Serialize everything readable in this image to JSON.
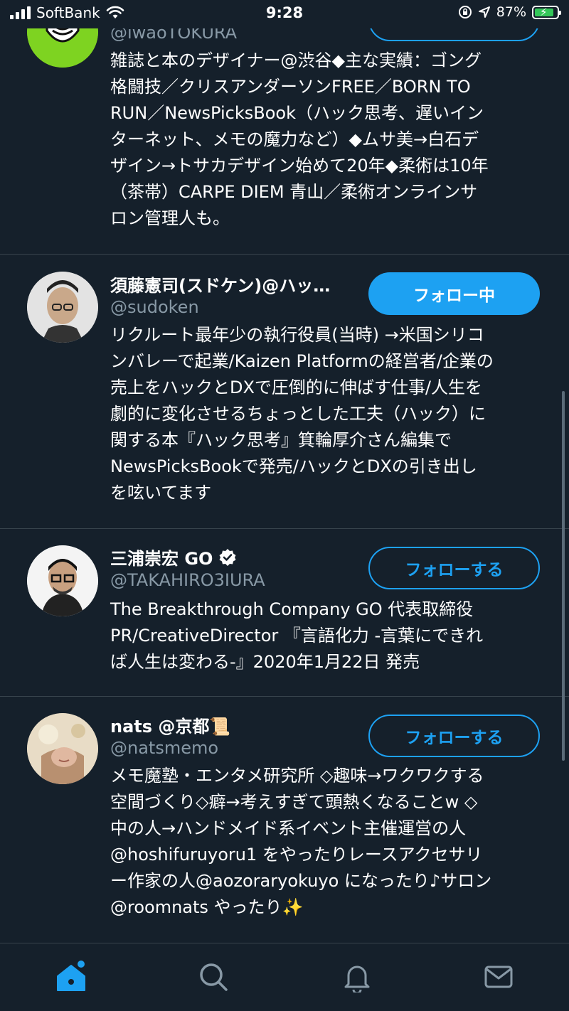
{
  "status_bar": {
    "carrier": "SoftBank",
    "time": "9:28",
    "battery_percent": "87%",
    "battery_level": 0.87,
    "icons": [
      "signal-icon",
      "wifi-icon",
      "lock-rotation-icon",
      "location-icon",
      "battery-icon"
    ]
  },
  "users": [
    {
      "name": "",
      "handle": "@iwaoTOKURA",
      "bio": "雑誌と本のデザイナー@渋谷◆主な実績：ゴング\n格闘技／クリスアンダーソンFREE／BORN TO\nRUN／NewsPicksBook（ハック思考、遅いイン\nターネット、メモの魔力など）◆ムサ美→白石デ\nザイン→トサカデザイン始めて20年◆柔術は10年\n（茶帯）CARPE DIEM 青山／柔術オンラインサ\nロン管理人も。",
      "avatar_color": "#7ed321"
    },
    {
      "name": "須藤憲司(スドケン)@ハッ…",
      "handle": "@sudoken",
      "follow_label": "フォロー中",
      "bio": "リクルート最年少の執行役員(当時) →米国シリコ\nンバレーで起業/Kaizen Platformの経営者/企業の\n売上をハックとDXで圧倒的に伸ばす仕事/人生を\n劇的に変化させるちょっとした工夫（ハック）に\n関する本『ハック思考』箕輪厚介さん編集で\nNewsPicksBookで発売/ハックとDXの引き出し\nを呟いてます"
    },
    {
      "name": "三浦崇宏 GO",
      "handle": "@TAKAHIRO3IURA",
      "follow_label": "フォローする",
      "verified": true,
      "bio": "The Breakthrough Company GO 代表取締役\nPR/CreativeDirector 『言語化力 -言葉にできれ\nば人生は変わる-』2020年1月22日 発売"
    },
    {
      "name": "nats @京都📜",
      "handle": "@natsmemo",
      "follow_label": "フォローする",
      "bio": "メモ魔塾・エンタメ研究所 ◇趣味→ワクワクする\n空間づくり◇癖→考えすぎて頭熱くなることw ◇\n中の人→ハンドメイド系イベント主催運営の人\n@hoshifuruyoru1 をやったりレースアクセサリ\nー作家の人@aozoraryokuyo になったり♪サロン\n@roomnats やったり✨"
    }
  ],
  "tab_bar": {
    "tabs": [
      "home-icon",
      "search-icon",
      "notifications-icon",
      "messages-icon"
    ],
    "active": "home-icon"
  },
  "colors": {
    "background": "#15202b",
    "accent": "#1da1f2",
    "secondary_text": "#8899a6",
    "divider": "#38444d"
  }
}
